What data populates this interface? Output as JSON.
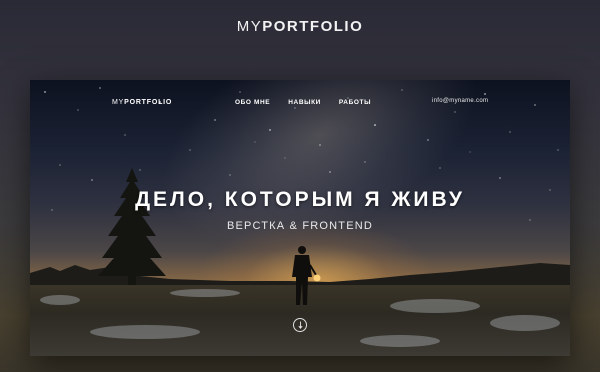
{
  "page_logo": {
    "light": "MY",
    "bold": "PORTFOLIO"
  },
  "nav": {
    "logo": {
      "light": "MY",
      "bold": "PORTFOLIO"
    },
    "items": [
      {
        "label": "ОБО МНЕ"
      },
      {
        "label": "НАВЫКИ"
      },
      {
        "label": "РАБОТЫ"
      }
    ],
    "email": "info@myname.com"
  },
  "hero": {
    "headline": "ДЕЛО, КОТОРЫМ Я ЖИВУ",
    "subheadline": "ВЕРСТКА & FRONTEND",
    "scroll_icon": "arrow-down-icon"
  }
}
